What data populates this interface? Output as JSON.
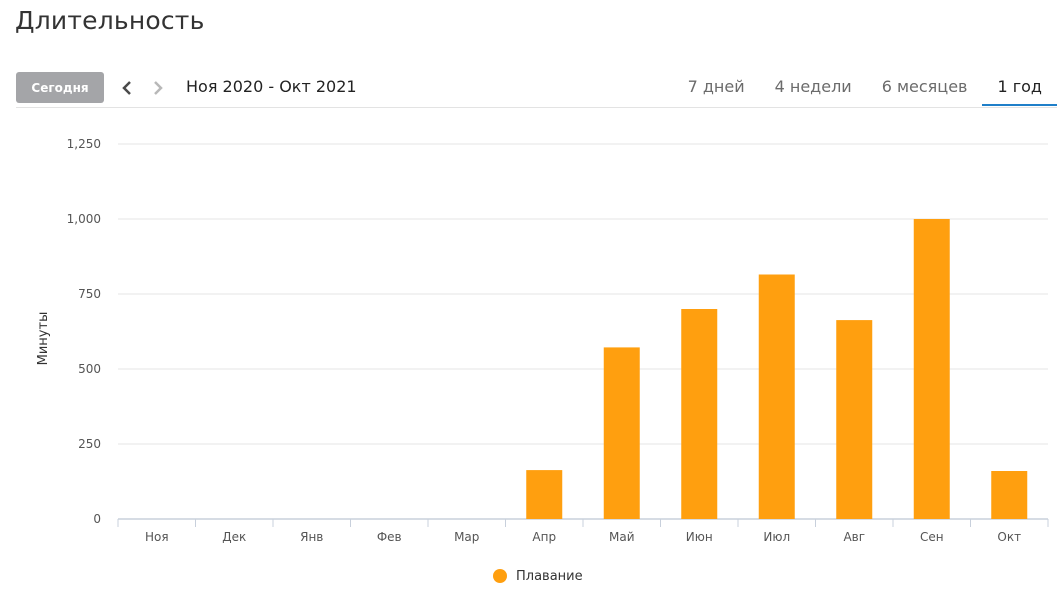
{
  "page": {
    "title": "Длительность"
  },
  "toolbar": {
    "today_label": "Сегодня",
    "prev_icon": "chevron-left-icon",
    "next_icon": "chevron-right-icon",
    "range_label": "Ноя 2020 - Окт 2021",
    "tabs": [
      {
        "label": "7 дней",
        "active": false
      },
      {
        "label": "4 недели",
        "active": false
      },
      {
        "label": "6 месяцев",
        "active": false
      },
      {
        "label": "1 год",
        "active": true
      }
    ]
  },
  "colors": {
    "accent": "#1f7fc9",
    "bar": "#ff9f0f",
    "grid": "#e6e6e6",
    "axis": "#c8d0dc",
    "today_button": "#a4a5a8"
  },
  "chart_data": {
    "type": "bar",
    "title": "",
    "xlabel": "",
    "ylabel": "Минуты",
    "ylim": [
      0,
      1250
    ],
    "yticks": [
      0,
      250,
      500,
      750,
      1000,
      1250
    ],
    "ytick_labels": [
      "0",
      "250",
      "500",
      "750",
      "1,000",
      "1,250"
    ],
    "grid": true,
    "legend_position": "bottom-center",
    "categories": [
      "Ноя",
      "Дек",
      "Янв",
      "Фев",
      "Мар",
      "Апр",
      "Май",
      "Июн",
      "Июл",
      "Авг",
      "Сен",
      "Окт"
    ],
    "series": [
      {
        "name": "Плавание",
        "color": "#ff9f0f",
        "values": [
          0,
          0,
          0,
          0,
          0,
          163,
          572,
          700,
          815,
          663,
          1000,
          160
        ]
      }
    ]
  }
}
